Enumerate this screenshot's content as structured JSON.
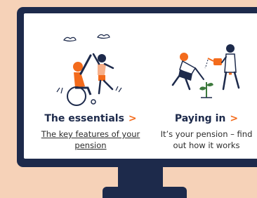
{
  "cards": [
    {
      "title": "The essentials",
      "chevron": ">",
      "description": "The key features of your pension",
      "illustration_icon": "high-five-wheelchair-illustration"
    },
    {
      "title": "Paying in",
      "chevron": ">",
      "description": "It’s your pension – find out how it works",
      "illustration_icon": "watering-plant-illustration"
    }
  ],
  "colors": {
    "background": "#f6d2b8",
    "monitor": "#1d2a4b",
    "accent": "#f36b1c",
    "text": "#1d2a4b"
  }
}
